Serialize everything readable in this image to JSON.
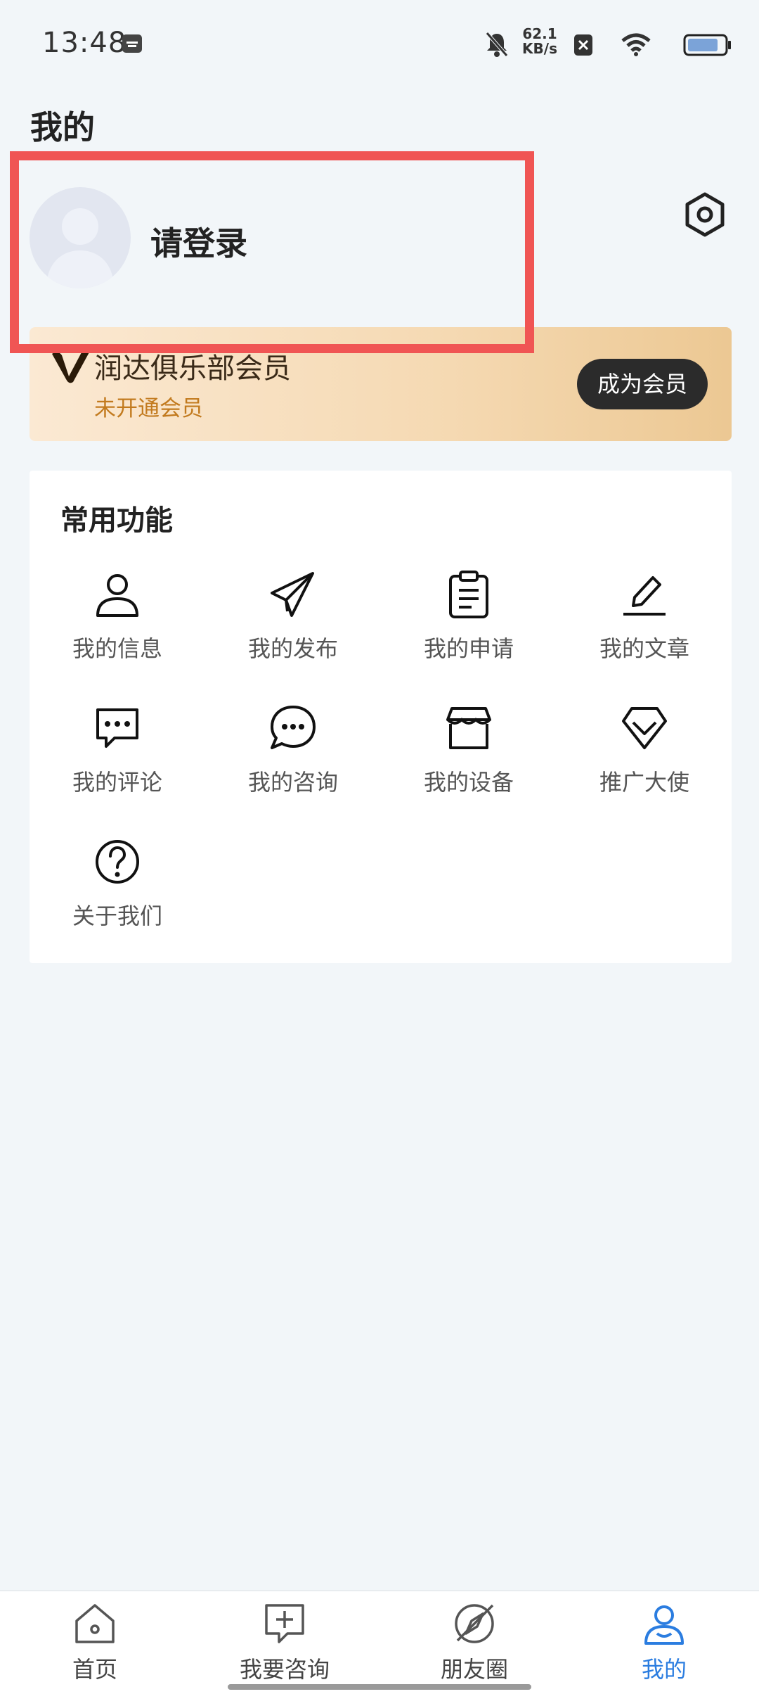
{
  "status_bar": {
    "time": "13:48",
    "net_speed_value": "62.1",
    "net_speed_unit": "KB/s"
  },
  "page": {
    "title": "我的"
  },
  "profile": {
    "login_prompt": "请登录"
  },
  "membership": {
    "title": "润达俱乐部会员",
    "status": "未开通会员",
    "cta_label": "成为会员"
  },
  "functions": {
    "title": "常用功能",
    "items": [
      {
        "label": "我的信息",
        "icon": "user-icon"
      },
      {
        "label": "我的发布",
        "icon": "paper-plane-icon"
      },
      {
        "label": "我的申请",
        "icon": "clipboard-icon"
      },
      {
        "label": "我的文章",
        "icon": "pencil-icon"
      },
      {
        "label": "我的评论",
        "icon": "comment-icon"
      },
      {
        "label": "我的咨询",
        "icon": "chat-bubble-icon"
      },
      {
        "label": "我的设备",
        "icon": "store-icon"
      },
      {
        "label": "推广大使",
        "icon": "diamond-icon"
      },
      {
        "label": "关于我们",
        "icon": "question-icon"
      }
    ]
  },
  "bottom_nav": {
    "items": [
      {
        "label": "首页",
        "icon": "home-icon"
      },
      {
        "label": "我要咨询",
        "icon": "consult-icon"
      },
      {
        "label": "朋友圈",
        "icon": "compass-icon"
      },
      {
        "label": "我的",
        "icon": "profile-icon",
        "active": true
      }
    ]
  },
  "colors": {
    "accent": "#2b7de0",
    "highlight": "#f05554",
    "member_status": "#c27a1e"
  }
}
